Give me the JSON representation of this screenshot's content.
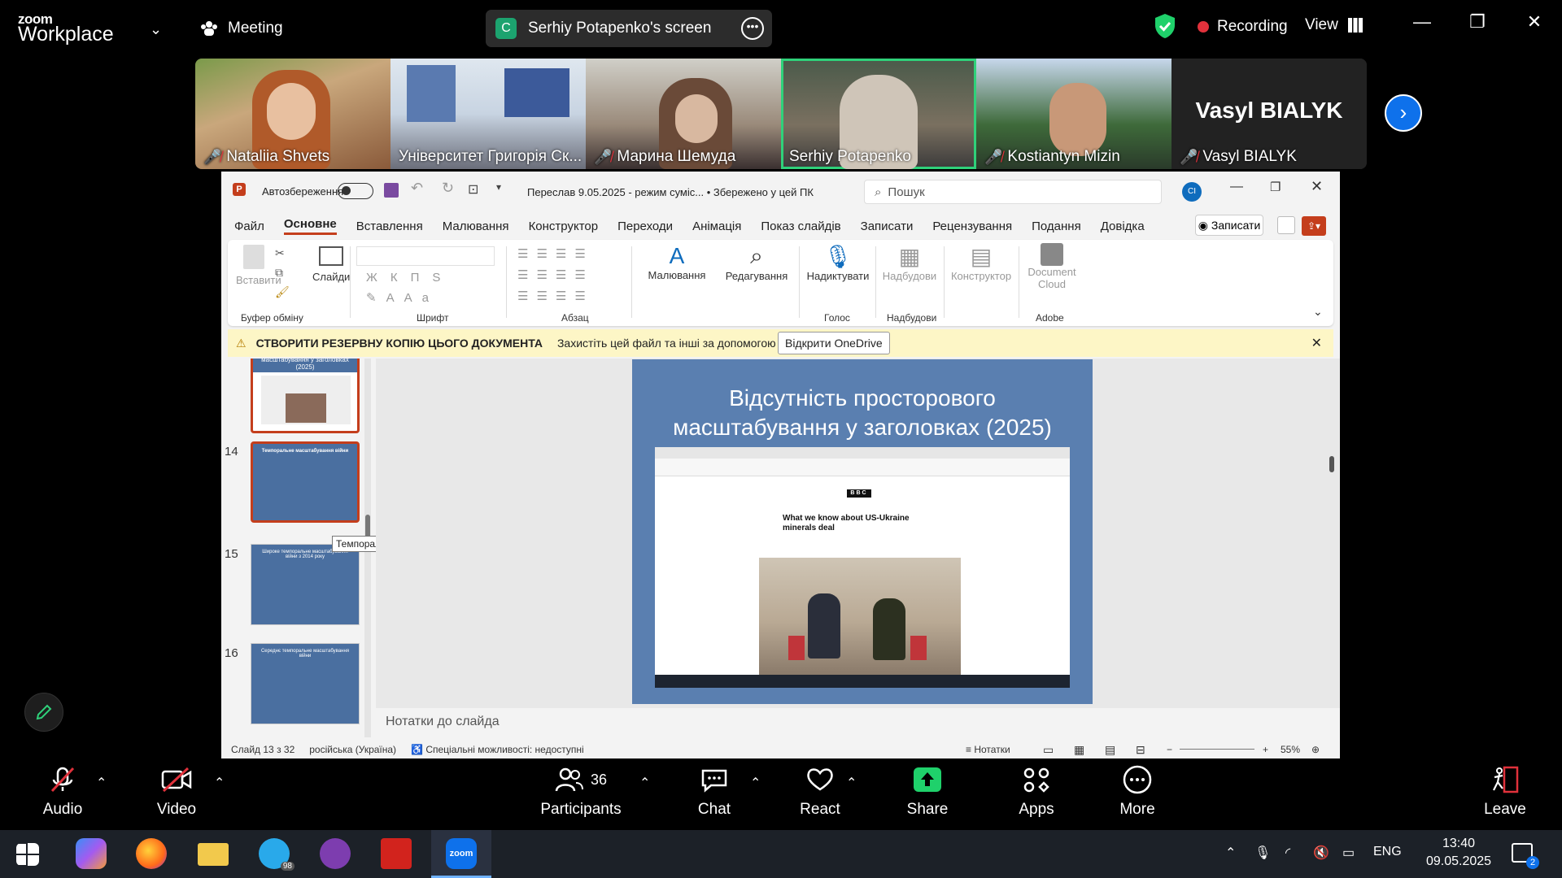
{
  "zoom": {
    "brand_small": "zoom",
    "brand_big": "Workplace",
    "meeting_label": "Meeting",
    "share_initial": "C",
    "share_title": "Serhiy Potapenko's screen",
    "recording_label": "Recording",
    "view_label": "View"
  },
  "participants_strip": [
    {
      "name": "Nataliia Shvets",
      "muted": true
    },
    {
      "name": "Університет Григорія Ск...",
      "muted": false
    },
    {
      "name": "Марина Шемуда",
      "muted": true
    },
    {
      "name": "Serhiy Potapenko",
      "muted": false
    },
    {
      "name": "Kostiantyn Mizin",
      "muted": true
    },
    {
      "name": "Vasyl BIALYK",
      "muted": true,
      "big_name": "Vasyl BIALYK"
    }
  ],
  "ppt": {
    "autosave_label": "Автозбереження",
    "file_title": "Переслав 9.05.2025  -  режим суміс...  •  Збережено у цей ПК",
    "search_placeholder": "Пошук",
    "avatar_initials": "CI",
    "menu": [
      "Файл",
      "Основне",
      "Вставлення",
      "Малювання",
      "Конструктор",
      "Переходи",
      "Анімація",
      "Показ слайдів",
      "Записати",
      "Рецензування",
      "Подання",
      "Довідка"
    ],
    "record_button": "Записати",
    "ribbon": {
      "paste": "Вставити",
      "clipboard_group": "Буфер обміну",
      "slides": "Слайди",
      "font_group": "Шрифт",
      "paragraph_group": "Абзац",
      "drawing": "Малювання",
      "editing": "Редагування",
      "dictate": "Надиктувати",
      "voice_group": "Голос",
      "addins": "Надбудови",
      "addins_group": "Надбудови",
      "designer": "Конструктор",
      "doc_cloud": "Document Cloud",
      "adobe_group": "Adobe"
    },
    "notice": {
      "title": "СТВОРИТИ РЕЗЕРВНУ КОПІЮ ЦЬОГО ДОКУМЕНТА",
      "text": "Захистіть цей файл та інші за допомогою OneDrive.",
      "button": "Відкрити OneDrive"
    },
    "thumbnails": [
      {
        "num": "",
        "caption": "масштабування у заголовках (2025)"
      },
      {
        "num": "14",
        "caption": "Темпоральне масштабування війни"
      },
      {
        "num": "15",
        "caption": "Широке темпоральне масштабування війни з 2014 року"
      },
      {
        "num": "16",
        "caption": "Середнє темпоральне масштабування війни"
      }
    ],
    "tooltip": "Темпоральне масштабування війн...",
    "slide": {
      "title_line1": "Відсутність просторового",
      "title_line2": "масштабування у заголовках (2025)",
      "article_headline": "What we know about US-Ukraine minerals deal",
      "site_logo": "BBC"
    },
    "notes_placeholder": "Нотатки до слайда",
    "status": {
      "slide_counter": "Слайд 13 з 32",
      "language": "російська (Україна)",
      "accessibility": "Спеціальні можливості: недоступні",
      "notes_button": "Нотатки",
      "zoom_level": "55%"
    }
  },
  "toolbar": {
    "audio": "Audio",
    "video": "Video",
    "participants": "Participants",
    "participants_count": "36",
    "chat": "Chat",
    "react": "React",
    "share": "Share",
    "apps": "Apps",
    "more": "More",
    "leave": "Leave"
  },
  "taskbar": {
    "telegram_badge": "98",
    "language": "ENG",
    "time": "13:40",
    "date": "09.05.2025",
    "notifications_count": "2"
  },
  "colors": {
    "zoom_blue": "#0e71eb",
    "share_green": "#1fd16b",
    "record_red": "#e0313b",
    "ppt_accent": "#c43e1c",
    "slide_bg": "#5a7fb0"
  }
}
